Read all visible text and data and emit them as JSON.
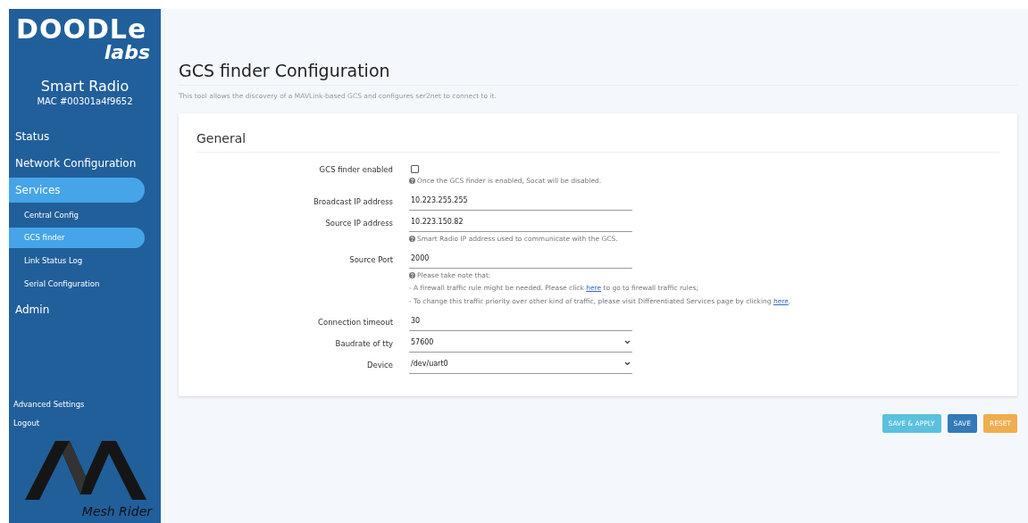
{
  "sidebar": {
    "logo": {
      "word": "DOODLe",
      "sub": "labs"
    },
    "device": {
      "title": "Smart Radio",
      "mac": "MAC #00301a4f9652"
    },
    "items": [
      {
        "label": "Status",
        "selected": false
      },
      {
        "label": "Network Configuration",
        "selected": false
      },
      {
        "label": "Services",
        "selected": true,
        "children": [
          {
            "label": "Central Config",
            "selected": false
          },
          {
            "label": "GCS finder",
            "selected": true
          },
          {
            "label": "Link Status Log",
            "selected": false
          },
          {
            "label": "Serial Configuration",
            "selected": false
          }
        ]
      },
      {
        "label": "Admin",
        "selected": false
      }
    ],
    "footer_links": [
      "Advanced Settings",
      "Logout"
    ],
    "brand": "Mesh Rider"
  },
  "page": {
    "title": "GCS finder Configuration",
    "description": "This tool allows the discovery of a MAVLink-based GCS and configures ser2net to connect to it."
  },
  "section": {
    "title": "General",
    "fields": [
      {
        "kind": "checkbox",
        "label": "GCS finder enabled",
        "checked": false,
        "help": [
          [
            {
              "text": "Once the GCS finder is enabled, Socat will be disabled."
            }
          ]
        ]
      },
      {
        "kind": "text",
        "label": "Broadcast IP address",
        "value": "10.223.255.255"
      },
      {
        "kind": "text",
        "label": "Source IP address",
        "value": "10.223.150.82",
        "help": [
          [
            {
              "text": "Smart Radio IP address used to communicate with the GCS."
            }
          ]
        ]
      },
      {
        "kind": "text",
        "label": "Source Port",
        "value": "2000",
        "help": [
          [
            {
              "text": "Please take note that:"
            }
          ],
          [
            {
              "text": "- A firewall traffic rule might be needed. Please click "
            },
            {
              "text": "here",
              "link": true
            },
            {
              "text": " to go to firewall traffic rules;"
            }
          ],
          [
            {
              "text": "- To change this traffic priority over other kind of traffic, please visit Differentiated Services page by clicking "
            },
            {
              "text": "here",
              "link": true
            },
            {
              "text": "."
            }
          ]
        ]
      },
      {
        "kind": "text",
        "label": "Connection timeout",
        "value": "30"
      },
      {
        "kind": "select",
        "label": "Baudrate of tty",
        "value": "57600"
      },
      {
        "kind": "select",
        "label": "Device",
        "value": "/dev/uart0"
      }
    ]
  },
  "buttons": [
    {
      "label": "SAVE & APPLY",
      "kind": "info"
    },
    {
      "label": "SAVE",
      "kind": "primary"
    },
    {
      "label": "RESET",
      "kind": "warning"
    }
  ]
}
